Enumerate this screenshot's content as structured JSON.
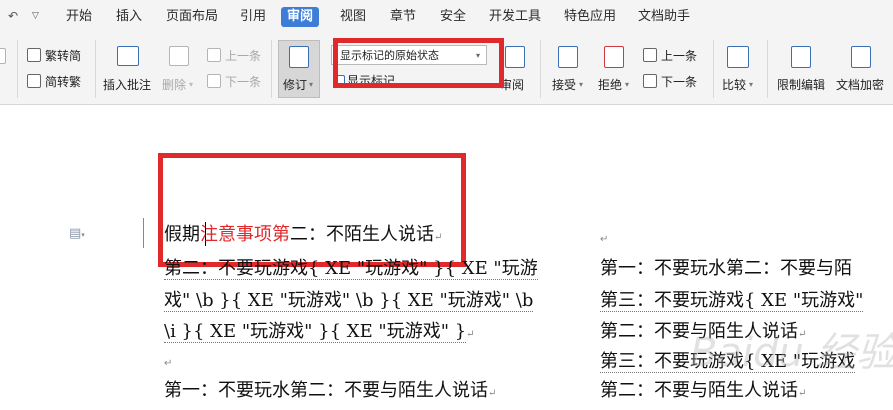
{
  "menu": {
    "tabs": [
      "开始",
      "插入",
      "页面布局",
      "引用",
      "审阅",
      "视图",
      "章节",
      "安全",
      "开发工具",
      "特色应用",
      "文档助手"
    ],
    "active": "审阅"
  },
  "ribbon": {
    "trad_simplified": "繁转简",
    "simplified_trad": "简转繁",
    "insert_comment": "插入批注",
    "delete": "删除",
    "prev_comment": "上一条",
    "next_comment": "下一条",
    "track_changes": "修订",
    "display_mode": "显示标记的原始状态",
    "show_markup": "显示标记",
    "review_pane": "审阅",
    "accept": "接受",
    "reject": "拒绝",
    "prev_change": "上一条",
    "next_change": "下一条",
    "compare": "比较",
    "restrict_editing": "限制编辑",
    "encrypt_doc": "文档加密"
  },
  "document": {
    "line1_a": "假期",
    "line1_deleted": "注意事项第",
    "line1_b": "二：不陌生人说话",
    "line2": "第二：不要玩游戏{ XE \"玩游戏\" }{ XE \"玩游",
    "line3": "戏\" \\b }{ XE \"玩游戏\" \\b }{ XE \"玩游戏\" \\b",
    "line4": "\\i }{ XE \"玩游戏\" }{ XE \"玩游戏\" }",
    "line6": "第一：不要玩水第二：不要与陌生人说话",
    "right1": "第一：不要玩水第二：不要与陌",
    "right2": "第三：不要玩游戏{ XE \"玩游戏\"",
    "right3": "第二：不要与陌生人说话",
    "right4": "第三：不要玩游戏{ XE \"玩游戏",
    "right5": "第二：不要与陌生人说话"
  },
  "watermark": "Baidu 经验"
}
